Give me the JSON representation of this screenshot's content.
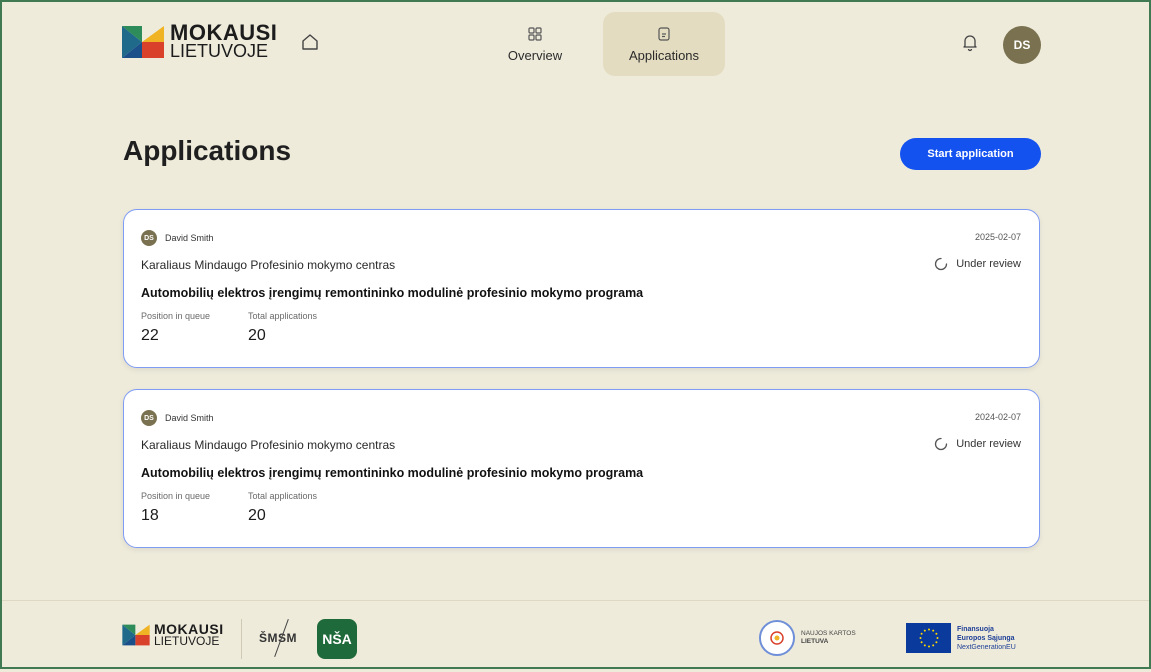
{
  "header": {
    "logo_line1": "MOKAUSI",
    "logo_line2": "LIETUVOJE",
    "home_icon": "home-icon",
    "nav": [
      {
        "label": "Overview",
        "icon": "grid-icon",
        "active": false
      },
      {
        "label": "Applications",
        "icon": "document-icon",
        "active": true
      }
    ],
    "bell_icon": "bell-icon",
    "avatar_initials": "DS"
  },
  "main": {
    "title": "Applications",
    "start_button_label": "Start application",
    "applications": [
      {
        "avatar_initials": "DS",
        "applicant": "David Smith",
        "date": "2025-02-07",
        "school": "Karaliaus Mindaugo Profesinio mokymo centras",
        "status": "Under review",
        "program": "Automobilių elektros įrengimų remontininko modulinė profesinio mokymo programa",
        "position_label": "Position in queue",
        "position_value": "22",
        "total_label": "Total applications",
        "total_value": "20"
      },
      {
        "avatar_initials": "DS",
        "applicant": "David Smith",
        "date": "2024-02-07",
        "school": "Karaliaus Mindaugo Profesinio mokymo centras",
        "status": "Under review",
        "program": "Automobilių elektros įrengimų remontininko modulinė profesinio mokymo programa",
        "position_label": "Position in queue",
        "position_value": "18",
        "total_label": "Total applications",
        "total_value": "20"
      }
    ]
  },
  "footer": {
    "logo_line1": "MOKAUSI",
    "logo_line2": "LIETUVOJE",
    "smsm": "ŠMSM",
    "nsa": "NŠA",
    "nk_line1": "NAUJOS KARTOS",
    "nk_line2": "LIETUVA",
    "eu_line1": "Finansuoja",
    "eu_line2": "Europos Sąjunga",
    "eu_line3": "NextGenerationEU"
  },
  "colors": {
    "background": "#eeebdb",
    "accent_blue": "#1452f0",
    "avatar": "#7a7150",
    "active_nav": "#e3dcc0",
    "card_border": "#7f9cf5"
  }
}
